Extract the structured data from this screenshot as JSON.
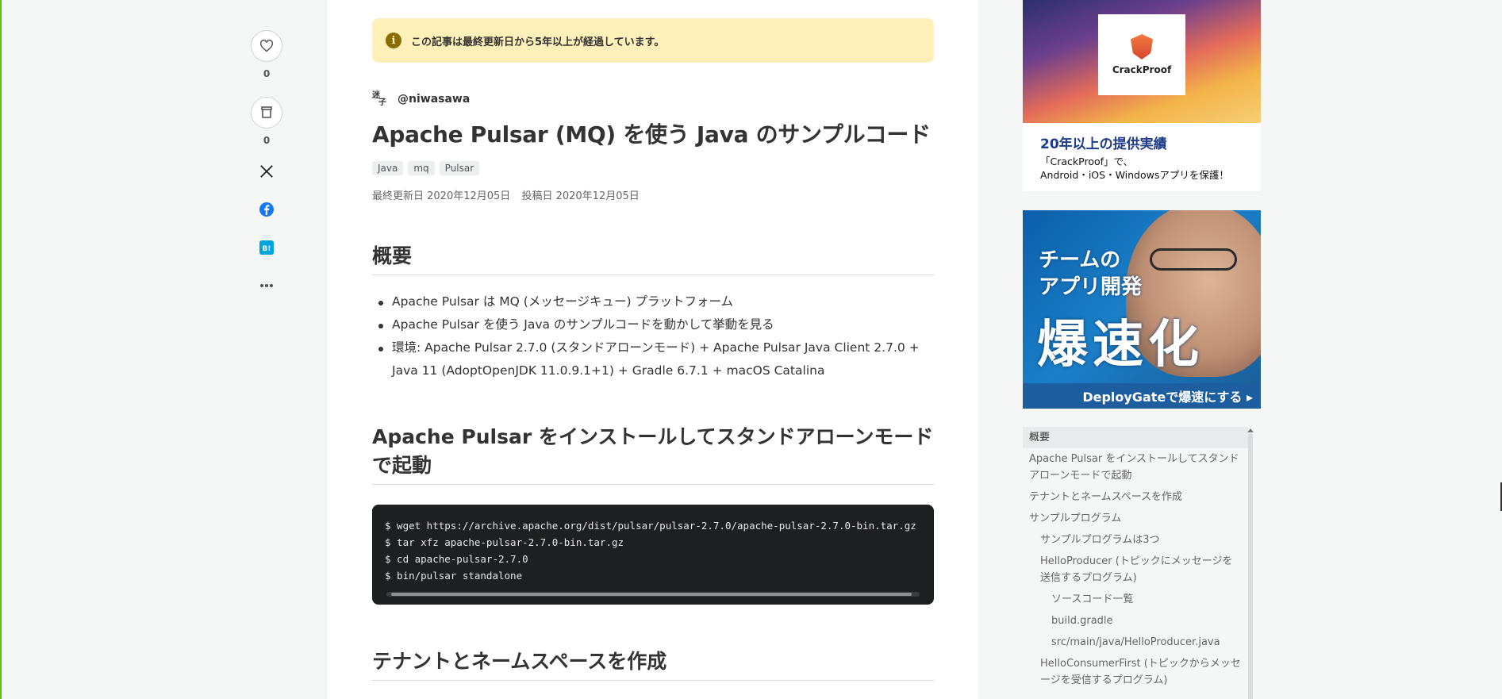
{
  "rail": {
    "like_count": "0",
    "stock_count": "0"
  },
  "notice": {
    "text": "この記事は最終更新日から5年以上が経過しています。",
    "icon": "info-icon"
  },
  "author": {
    "avatar_text_top": "迷",
    "avatar_text_bottom": "子",
    "handle": "@niwasawa"
  },
  "article": {
    "title": "Apache Pulsar (MQ) を使う Java のサンプルコード",
    "tags": [
      "Java",
      "mq",
      "Pulsar"
    ],
    "updated": "最終更新日 2020年12月05日",
    "posted": "投稿日 2020年12月05日",
    "section1_heading": "概要",
    "bullets": [
      "Apache Pulsar は MQ (メッセージキュー) プラットフォーム",
      "Apache Pulsar を使う Java のサンプルコードを動かして挙動を見る",
      "環境: Apache Pulsar 2.7.0 (スタンドアローンモード) + Apache Pulsar Java Client 2.7.0 + Java 11 (AdoptOpenJDK 11.0.9.1+1) + Gradle 6.7.1 + macOS Catalina"
    ],
    "section2_heading": "Apache Pulsar をインストールしてスタンドアローンモードで起動",
    "code_lines": [
      "$ wget https://archive.apache.org/dist/pulsar/pulsar-2.7.0/apache-pulsar-2.7.0-bin.tar.gz",
      "$ tar xfz apache-pulsar-2.7.0-bin.tar.gz",
      "$ cd apache-pulsar-2.7.0",
      "$ bin/pulsar standalone"
    ],
    "section3_heading": "テナントとネームスペースを作成"
  },
  "ads": {
    "ad1_logo": "CrackProof",
    "ad1_head": "20年以上の提供実績",
    "ad1_sub1": "「CrackProof」で、",
    "ad1_sub2": "Android・iOS・Windowsアプリを保護！",
    "ad2_line1": "チームの",
    "ad2_line2": "アプリ開発",
    "ad2_big": "爆速化",
    "ad2_cta": "DeployGateで爆速にする ▸"
  },
  "toc": {
    "items": [
      {
        "label": "概要",
        "level": 1
      },
      {
        "label": "Apache Pulsar をインストールしてスタンドアローンモードで起動",
        "level": 1
      },
      {
        "label": "テナントとネームスペースを作成",
        "level": 1
      },
      {
        "label": "サンプルプログラム",
        "level": 1
      },
      {
        "label": "サンプルプログラムは3つ",
        "level": 2
      },
      {
        "label": "HelloProducer (トピックにメッセージを送信するプログラム)",
        "level": 2
      },
      {
        "label": "ソースコード一覧",
        "level": 3
      },
      {
        "label": "build.gradle",
        "level": 3
      },
      {
        "label": "src/main/java/HelloProducer.java",
        "level": 3
      },
      {
        "label": "HelloConsumerFirst (トピックからメッセージを受信するプログラム)",
        "level": 2
      }
    ]
  }
}
